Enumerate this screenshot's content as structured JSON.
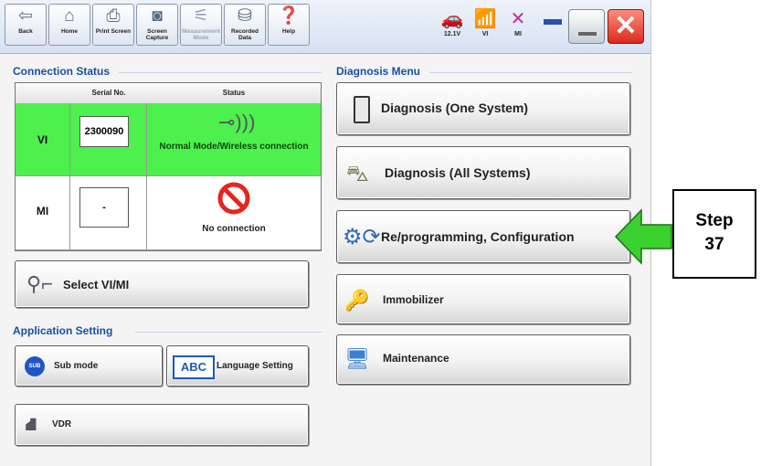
{
  "toolbar": {
    "back": "Back",
    "home": "Home",
    "print_screen": "Print Screen",
    "screen_capture": "Screen Capture",
    "measurement_mode": "Measurement Mode",
    "recorded_data": "Recorded Data",
    "help": "Help",
    "voltage": "12.1V",
    "vi": "VI",
    "mi": "MI"
  },
  "connection_status": {
    "title": "Connection Status",
    "headers": {
      "serial": "Serial No.",
      "status": "Status"
    },
    "vi": {
      "label": "VI",
      "serial": "2300090",
      "status": "Normal Mode/Wireless connection"
    },
    "mi": {
      "label": "MI",
      "serial": "-",
      "status": "No connection"
    }
  },
  "select_button": "Select VI/MI",
  "application_setting": {
    "title": "Application Setting",
    "sub_mode": "Sub mode",
    "sub_icon": "SUB",
    "language": "Language Setting",
    "abc": "ABC"
  },
  "vdr": "VDR",
  "diagnosis_menu": {
    "title": "Diagnosis Menu",
    "items": [
      "Diagnosis (One System)",
      "Diagnosis (All Systems)",
      "Re/programming, Configuration",
      "Immobilizer",
      "Maintenance"
    ]
  },
  "callout": {
    "line1": "Step",
    "line2": "37",
    "arrow_color": "#3bd12e"
  }
}
